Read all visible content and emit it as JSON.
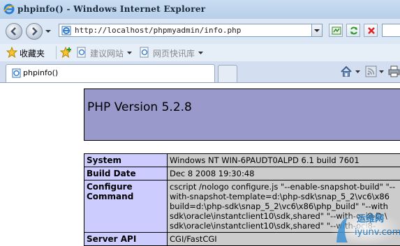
{
  "window": {
    "title": "phpinfo() - Windows Internet Explorer"
  },
  "navbar": {
    "url": "http://localhost/phpmyadmin/info.php"
  },
  "favorites": {
    "label": "收藏夹",
    "suggested_sites": "建议网站",
    "web_slice_gallery": "网页快讯库"
  },
  "tab": {
    "label": "phpinfo()"
  },
  "page": {
    "php_version": "PHP Version 5.2.8",
    "rows": [
      {
        "key": "System",
        "lines": [
          "Windows NT WIN-6PAUDT0ALPD 6.1 build 7601"
        ]
      },
      {
        "key": "Build Date",
        "lines": [
          "Dec 8 2008 19:30:48"
        ]
      },
      {
        "key": "Configure Command",
        "key_lines": [
          "Configure",
          "Command"
        ],
        "lines": [
          "cscript /nologo configure.js \"--enable-snapshot-build\" \"--",
          "with-snapshot-template=d:\\php-sdk\\snap_5_2\\vc6\\x86",
          "build=d:\\php-sdk\\snap_5_2\\vc6\\x86\\php_build\" \"--with",
          "sdk\\oracle\\instantclient10\\sdk,shared\" \"--with-oci8-D:\\",
          "sdk\\oracle\\instantclient10\\sdk,shared\" \"--with-oci8-"
        ]
      },
      {
        "key": "Server API",
        "lines": [
          "CGI/FastCGI"
        ]
      }
    ]
  },
  "watermark": {
    "line1": "运维网",
    "line2": "iyunv.com"
  },
  "colors": {
    "header_bg": "#9999cc",
    "key_bg": "#ccccff",
    "value_bg": "#cccccc"
  }
}
